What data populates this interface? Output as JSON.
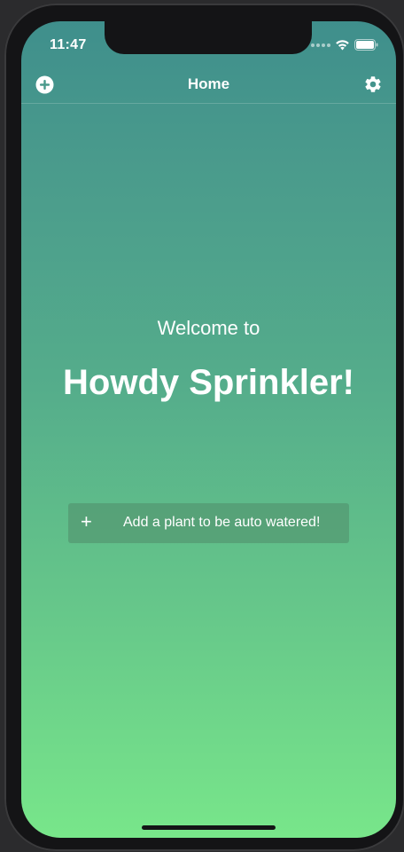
{
  "status_bar": {
    "time": "11:47",
    "icons": [
      "signal-dots-icon",
      "wifi-icon",
      "battery-icon"
    ]
  },
  "nav": {
    "title": "Home",
    "left_icon": "add-circle-icon",
    "right_icon": "gear-icon"
  },
  "main": {
    "welcome": "Welcome to",
    "headline": "Howdy Sprinkler!",
    "add_plant_button": {
      "icon": "+",
      "label": "Add a plant to be auto watered!"
    }
  },
  "colors": {
    "gradient_top": "#3f8f8c",
    "gradient_bottom": "#78e68a",
    "button_bg": "#508c69",
    "text": "#ffffff",
    "device_frame": "#141416"
  }
}
